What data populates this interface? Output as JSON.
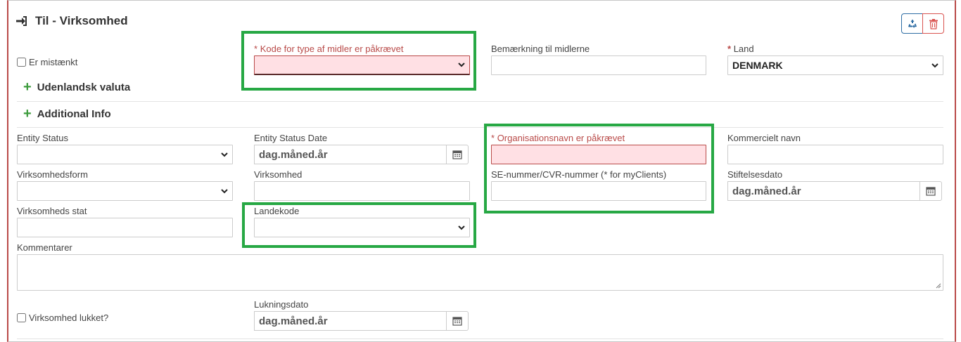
{
  "header": {
    "title": "Til - Virksomhed",
    "icons": {
      "title_icon": "sign-in-icon",
      "recycle": "recycle-icon",
      "delete": "trash-icon"
    }
  },
  "form": {
    "er_mistaenkt": {
      "label": "Er mistænkt",
      "checked": false
    },
    "kode_type": {
      "label": "Kode for type af midler er påkrævet",
      "value": "",
      "required_mark": "*"
    },
    "bemaerkning": {
      "label": "Bemærkning til midlerne",
      "value": ""
    },
    "land": {
      "label": "Land",
      "value": "DENMARK",
      "required_mark": "*"
    },
    "udenlandsk_valuta": {
      "label": "Udenlandsk valuta",
      "icon": "plus-icon"
    },
    "additional_info": {
      "label": "Additional Info",
      "icon": "plus-icon"
    },
    "entity_status": {
      "label": "Entity Status",
      "value": ""
    },
    "entity_status_date": {
      "label": "Entity Status Date",
      "placeholder": "dag.måned.år"
    },
    "organisationsnavn": {
      "label": "Organisationsnavn er påkrævet",
      "value": "",
      "required_mark": "*"
    },
    "kommercielt_navn": {
      "label": "Kommercielt navn",
      "value": ""
    },
    "virksomhedsform": {
      "label": "Virksomhedsform",
      "value": ""
    },
    "virksomhed": {
      "label": "Virksomhed",
      "value": ""
    },
    "se_nummer": {
      "label": "SE-nummer/CVR-nummer (* for myClients)",
      "value": ""
    },
    "stiftelsesdato": {
      "label": "Stiftelsesdato",
      "placeholder": "dag.måned.år"
    },
    "virksomheds_stat": {
      "label": "Virksomheds stat",
      "value": ""
    },
    "landekode": {
      "label": "Landekode",
      "value": ""
    },
    "kommentarer": {
      "label": "Kommentarer",
      "value": ""
    },
    "virksomhed_lukket": {
      "label": "Virksomhed lukket?",
      "checked": false
    },
    "lukningsdato": {
      "label": "Lukningsdato",
      "placeholder": "dag.måned.år"
    }
  },
  "colors": {
    "error": "#b94a48",
    "error_bg": "#ffe0e4",
    "highlight": "#27a844",
    "plus": "#3c9b3c",
    "primary": "#2e6da4",
    "danger": "#d9534f"
  }
}
